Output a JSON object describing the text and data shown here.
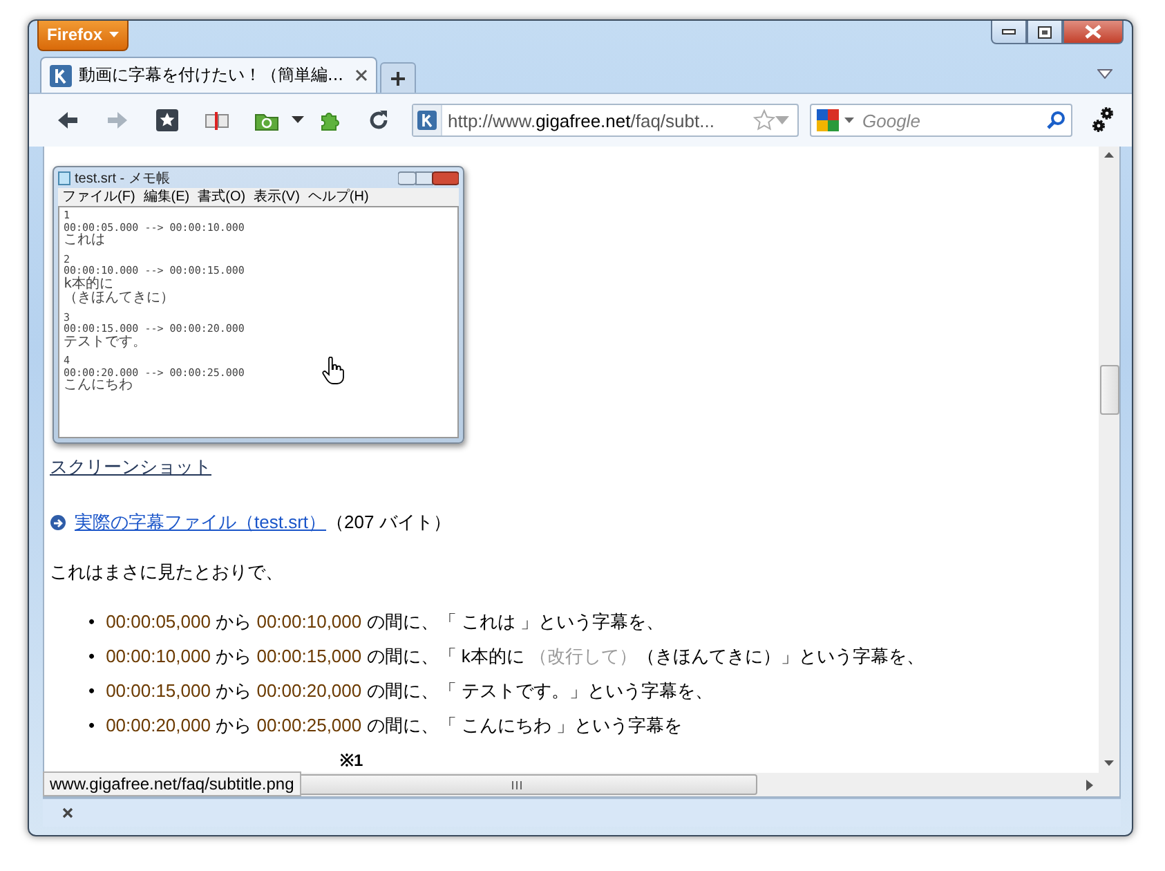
{
  "firefox_button": {
    "label": "Firefox"
  },
  "tabs": [
    {
      "title": "動画に字幕を付けたい！（簡単編...",
      "selected": true
    }
  ],
  "url": {
    "scheme": "http://www.",
    "host": "gigafree.net",
    "path": "/faq/subt..."
  },
  "search": {
    "placeholder": "Google"
  },
  "notepad": {
    "title": "test.srt - メモ帳",
    "menu": [
      "ファイル(F)",
      "編集(E)",
      "書式(O)",
      "表示(V)",
      "ヘルプ(H)"
    ],
    "lines": [
      {
        "kind": "ascii",
        "text": "1"
      },
      {
        "kind": "ascii",
        "text": "00:00:05.000 --> 00:00:10.000"
      },
      {
        "kind": "text",
        "text": "これは"
      },
      {
        "kind": "gap"
      },
      {
        "kind": "ascii",
        "text": "2"
      },
      {
        "kind": "ascii",
        "text": "00:00:10.000 --> 00:00:15.000"
      },
      {
        "kind": "text",
        "text": "k本的に"
      },
      {
        "kind": "text",
        "text": "（きほんてきに）"
      },
      {
        "kind": "gap"
      },
      {
        "kind": "ascii",
        "text": "3"
      },
      {
        "kind": "ascii",
        "text": "00:00:15.000 --> 00:00:20.000"
      },
      {
        "kind": "text",
        "text": "テストです。"
      },
      {
        "kind": "gap"
      },
      {
        "kind": "ascii",
        "text": "4"
      },
      {
        "kind": "ascii",
        "text": "00:00:20.000 --> 00:00:25.000"
      },
      {
        "kind": "text",
        "text": "こんにちわ"
      }
    ]
  },
  "screenshot_link": "スクリーンショット",
  "file_link": "実際の字幕ファイル（test.srt）",
  "file_size": "（207 バイト）",
  "intro": "これはまさに見たとおりで、",
  "items": [
    {
      "bullet": "•",
      "start": "00:00:05,000",
      "from": "から",
      "end": "00:00:10,000",
      "text": "の間に、「 これは 」という字幕を、"
    },
    {
      "bullet": "•",
      "start": "00:00:10,000",
      "from": "から",
      "end": "00:00:15,000",
      "text": "の間に、「 k本的に ",
      "note": "（改行して）",
      "after": "（きほんてきに）」という字幕を、"
    },
    {
      "bullet": "•",
      "start": "00:00:15,000",
      "from": "から",
      "end": "00:00:20,000",
      "text": "の間に、「 テストです。」という字幕を、"
    },
    {
      "bullet": "•",
      "start": "00:00:20,000",
      "from": "から",
      "end": "00:00:25,000",
      "text": "の間に、「 こんにちわ 」という字幕を"
    }
  ],
  "footnote": "※1",
  "status_tooltip": "www.gigafree.net/faq/subtitle.png"
}
